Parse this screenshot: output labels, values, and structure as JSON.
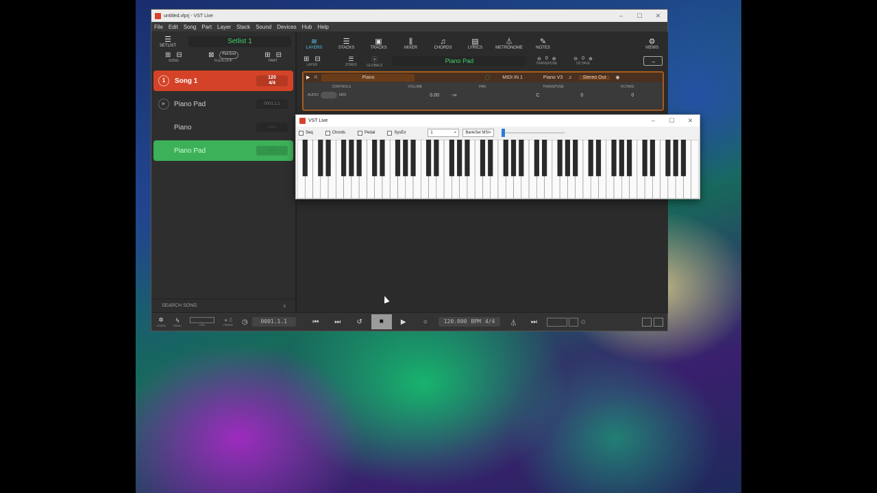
{
  "main_window": {
    "title": "untitled.vlprj - VST Live",
    "controls": [
      "–",
      "☐",
      "✕"
    ],
    "menu": [
      "File",
      "Edit",
      "Song",
      "Part",
      "Layer",
      "Stack",
      "Sound",
      "Devices",
      "Hub",
      "Help"
    ]
  },
  "left_panel": {
    "setlist_label": "SETLIST",
    "setlist_name": "Setlist 1",
    "tools": {
      "song_label": "SONG",
      "flexloop_label": "FLEXLOOP",
      "flexloop_pill": "Part End",
      "part_label": "PART"
    },
    "song": {
      "number": "1",
      "name": "Song 1",
      "tempo": "120",
      "signature": "4/4"
    },
    "parts": [
      {
        "name": "Piano Pad",
        "time": "0001.1.1"
      },
      {
        "name": "Piano",
        "time": "-:-:-:-"
      },
      {
        "name": "Piano Pad",
        "time": "-:-:-:-"
      }
    ],
    "search_label": "SEARCH SONG",
    "search_clear": "x"
  },
  "toolbar": {
    "items": [
      {
        "icon": "layers-icon",
        "glyph": "≋",
        "label": "LAYERS"
      },
      {
        "icon": "stacks-icon",
        "glyph": "☰",
        "label": "STACKS"
      },
      {
        "icon": "tracks-icon",
        "glyph": "▣",
        "label": "TRACKS"
      },
      {
        "icon": "mixer-icon",
        "glyph": "⫼",
        "label": "MIXER"
      },
      {
        "icon": "chords-icon",
        "glyph": "♫",
        "label": "CHORDS"
      },
      {
        "icon": "lyrics-icon",
        "glyph": "▤",
        "label": "LYRICS"
      },
      {
        "icon": "metronome-icon",
        "glyph": "⏃",
        "label": "METRONOME"
      },
      {
        "icon": "notes-icon",
        "glyph": "✎",
        "label": "NOTES"
      }
    ],
    "views_label": "VIEWS"
  },
  "layer_tools": {
    "layer_label": "LAYER",
    "zones_label": "ZONES",
    "globals_label": "GLOBALS",
    "current_part": "Piano Pad",
    "transpose_label": "TRANSPOSE",
    "transpose_value": "0",
    "octave_label": "OCTAVE",
    "octave_value": "0"
  },
  "layer": {
    "name": "Piano",
    "midi_in": "MIDI IN 1",
    "instrument": "Piano V3",
    "output": "Stereo Out",
    "controls_label": "CONTROLS",
    "audio_label": "AUDIO",
    "midi_label": "MIDI",
    "volume_label": "VOLUME",
    "volume_value": "0.00",
    "volume_inf": "-∞",
    "pan_label": "PAN",
    "pan_value": "C",
    "transpose_label": "TRANSPOSE",
    "transpose_value": "0",
    "octave_label": "OCTAVE",
    "octave_value": "0"
  },
  "transport": {
    "learn_label": "LEARN",
    "panic_label": "PANIC",
    "cpu_label": "CPU",
    "peers_label": "PEERS",
    "peers_count": "0",
    "position": "0001.1.1",
    "tempo": "120.000",
    "bpm_label": "BPM",
    "signature": "4/4"
  },
  "vst_window": {
    "title": "VST Live",
    "options": [
      "Seq",
      "Chords",
      "Pedal",
      "SysEx"
    ],
    "channel": "1",
    "bank_select": "BankSel MSI",
    "slider_level": 0.0,
    "white_key_count": 52
  }
}
